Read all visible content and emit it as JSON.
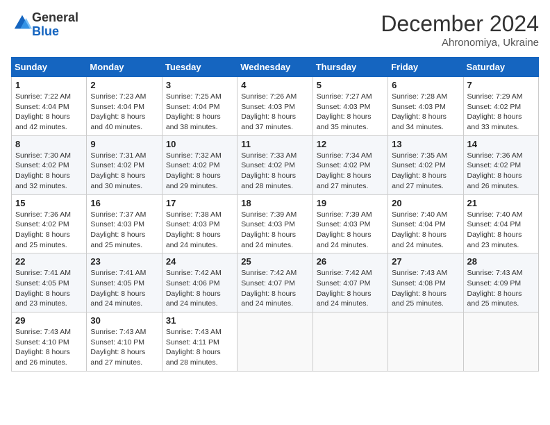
{
  "header": {
    "logo": {
      "general": "General",
      "blue": "Blue"
    },
    "month_title": "December 2024",
    "location": "Ahronomiya, Ukraine"
  },
  "calendar": {
    "weekdays": [
      "Sunday",
      "Monday",
      "Tuesday",
      "Wednesday",
      "Thursday",
      "Friday",
      "Saturday"
    ],
    "weeks": [
      [
        {
          "day": "1",
          "sunrise": "7:22 AM",
          "sunset": "4:04 PM",
          "daylight": "8 hours and 42 minutes."
        },
        {
          "day": "2",
          "sunrise": "7:23 AM",
          "sunset": "4:04 PM",
          "daylight": "8 hours and 40 minutes."
        },
        {
          "day": "3",
          "sunrise": "7:25 AM",
          "sunset": "4:04 PM",
          "daylight": "8 hours and 38 minutes."
        },
        {
          "day": "4",
          "sunrise": "7:26 AM",
          "sunset": "4:03 PM",
          "daylight": "8 hours and 37 minutes."
        },
        {
          "day": "5",
          "sunrise": "7:27 AM",
          "sunset": "4:03 PM",
          "daylight": "8 hours and 35 minutes."
        },
        {
          "day": "6",
          "sunrise": "7:28 AM",
          "sunset": "4:03 PM",
          "daylight": "8 hours and 34 minutes."
        },
        {
          "day": "7",
          "sunrise": "7:29 AM",
          "sunset": "4:02 PM",
          "daylight": "8 hours and 33 minutes."
        }
      ],
      [
        {
          "day": "8",
          "sunrise": "7:30 AM",
          "sunset": "4:02 PM",
          "daylight": "8 hours and 32 minutes."
        },
        {
          "day": "9",
          "sunrise": "7:31 AM",
          "sunset": "4:02 PM",
          "daylight": "8 hours and 30 minutes."
        },
        {
          "day": "10",
          "sunrise": "7:32 AM",
          "sunset": "4:02 PM",
          "daylight": "8 hours and 29 minutes."
        },
        {
          "day": "11",
          "sunrise": "7:33 AM",
          "sunset": "4:02 PM",
          "daylight": "8 hours and 28 minutes."
        },
        {
          "day": "12",
          "sunrise": "7:34 AM",
          "sunset": "4:02 PM",
          "daylight": "8 hours and 27 minutes."
        },
        {
          "day": "13",
          "sunrise": "7:35 AM",
          "sunset": "4:02 PM",
          "daylight": "8 hours and 27 minutes."
        },
        {
          "day": "14",
          "sunrise": "7:36 AM",
          "sunset": "4:02 PM",
          "daylight": "8 hours and 26 minutes."
        }
      ],
      [
        {
          "day": "15",
          "sunrise": "7:36 AM",
          "sunset": "4:02 PM",
          "daylight": "8 hours and 25 minutes."
        },
        {
          "day": "16",
          "sunrise": "7:37 AM",
          "sunset": "4:03 PM",
          "daylight": "8 hours and 25 minutes."
        },
        {
          "day": "17",
          "sunrise": "7:38 AM",
          "sunset": "4:03 PM",
          "daylight": "8 hours and 24 minutes."
        },
        {
          "day": "18",
          "sunrise": "7:39 AM",
          "sunset": "4:03 PM",
          "daylight": "8 hours and 24 minutes."
        },
        {
          "day": "19",
          "sunrise": "7:39 AM",
          "sunset": "4:03 PM",
          "daylight": "8 hours and 24 minutes."
        },
        {
          "day": "20",
          "sunrise": "7:40 AM",
          "sunset": "4:04 PM",
          "daylight": "8 hours and 24 minutes."
        },
        {
          "day": "21",
          "sunrise": "7:40 AM",
          "sunset": "4:04 PM",
          "daylight": "8 hours and 23 minutes."
        }
      ],
      [
        {
          "day": "22",
          "sunrise": "7:41 AM",
          "sunset": "4:05 PM",
          "daylight": "8 hours and 23 minutes."
        },
        {
          "day": "23",
          "sunrise": "7:41 AM",
          "sunset": "4:05 PM",
          "daylight": "8 hours and 24 minutes."
        },
        {
          "day": "24",
          "sunrise": "7:42 AM",
          "sunset": "4:06 PM",
          "daylight": "8 hours and 24 minutes."
        },
        {
          "day": "25",
          "sunrise": "7:42 AM",
          "sunset": "4:07 PM",
          "daylight": "8 hours and 24 minutes."
        },
        {
          "day": "26",
          "sunrise": "7:42 AM",
          "sunset": "4:07 PM",
          "daylight": "8 hours and 24 minutes."
        },
        {
          "day": "27",
          "sunrise": "7:43 AM",
          "sunset": "4:08 PM",
          "daylight": "8 hours and 25 minutes."
        },
        {
          "day": "28",
          "sunrise": "7:43 AM",
          "sunset": "4:09 PM",
          "daylight": "8 hours and 25 minutes."
        }
      ],
      [
        {
          "day": "29",
          "sunrise": "7:43 AM",
          "sunset": "4:10 PM",
          "daylight": "8 hours and 26 minutes."
        },
        {
          "day": "30",
          "sunrise": "7:43 AM",
          "sunset": "4:10 PM",
          "daylight": "8 hours and 27 minutes."
        },
        {
          "day": "31",
          "sunrise": "7:43 AM",
          "sunset": "4:11 PM",
          "daylight": "8 hours and 28 minutes."
        },
        null,
        null,
        null,
        null
      ]
    ]
  }
}
